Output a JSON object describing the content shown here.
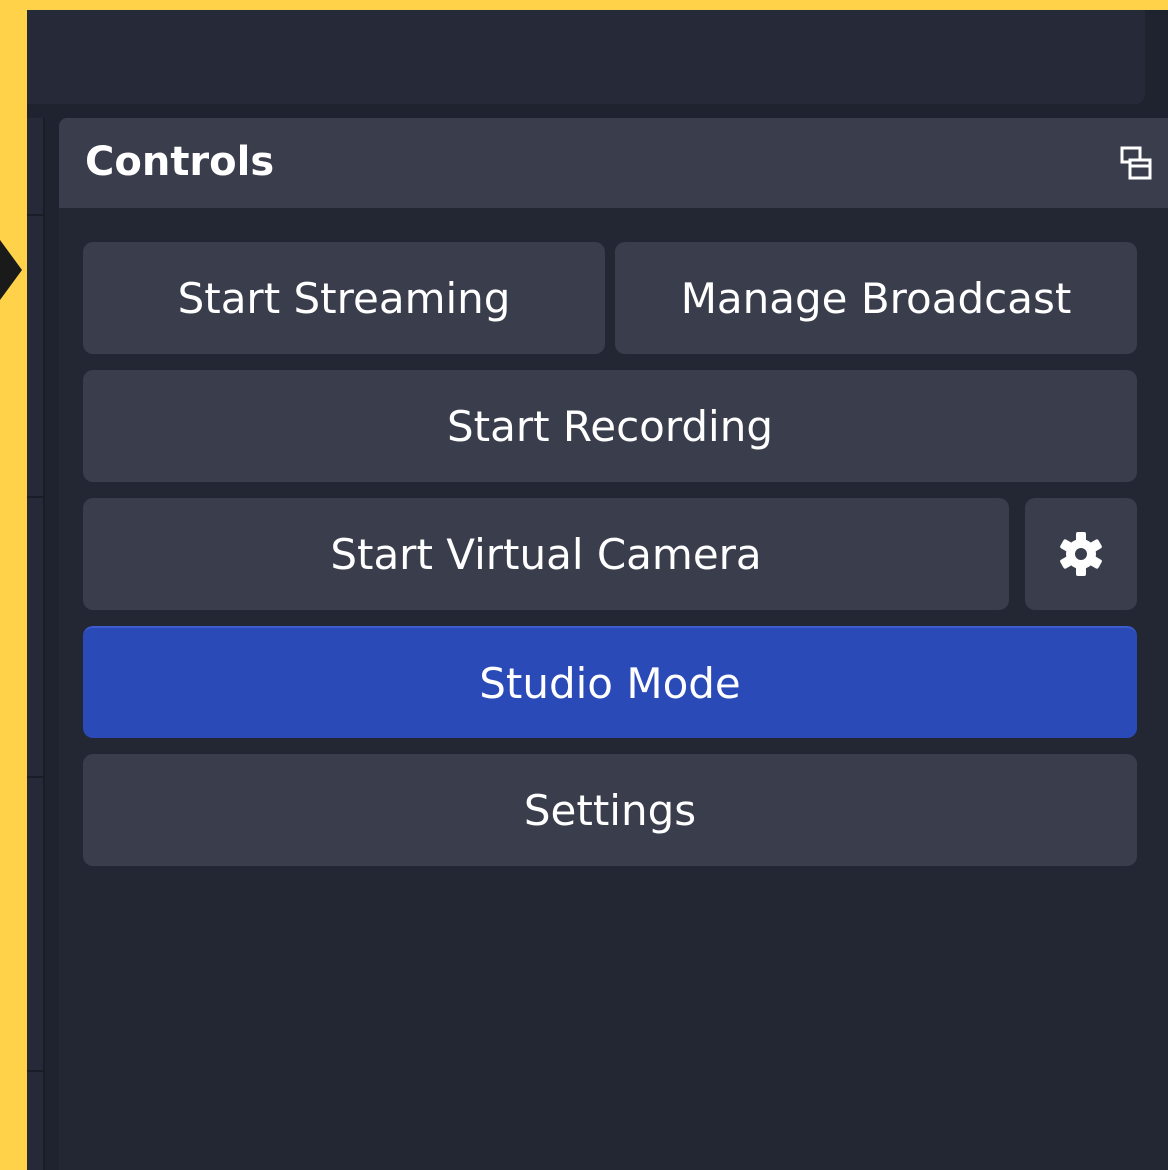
{
  "dock": {
    "title": "Controls"
  },
  "controls": {
    "start_streaming": "Start Streaming",
    "manage_broadcast": "Manage Broadcast",
    "start_recording": "Start Recording",
    "start_virtual_camera": "Start Virtual Camera",
    "studio_mode": "Studio Mode",
    "settings": "Settings"
  },
  "icons": {
    "virtual_camera_settings": "gear-icon",
    "dock_float": "float-dock-icon"
  },
  "colors": {
    "background_frame": "#ffd24a",
    "panel": "#232734",
    "button": "#3a3d4c",
    "active_button": "#2a4ab8",
    "text": "#ffffff"
  }
}
